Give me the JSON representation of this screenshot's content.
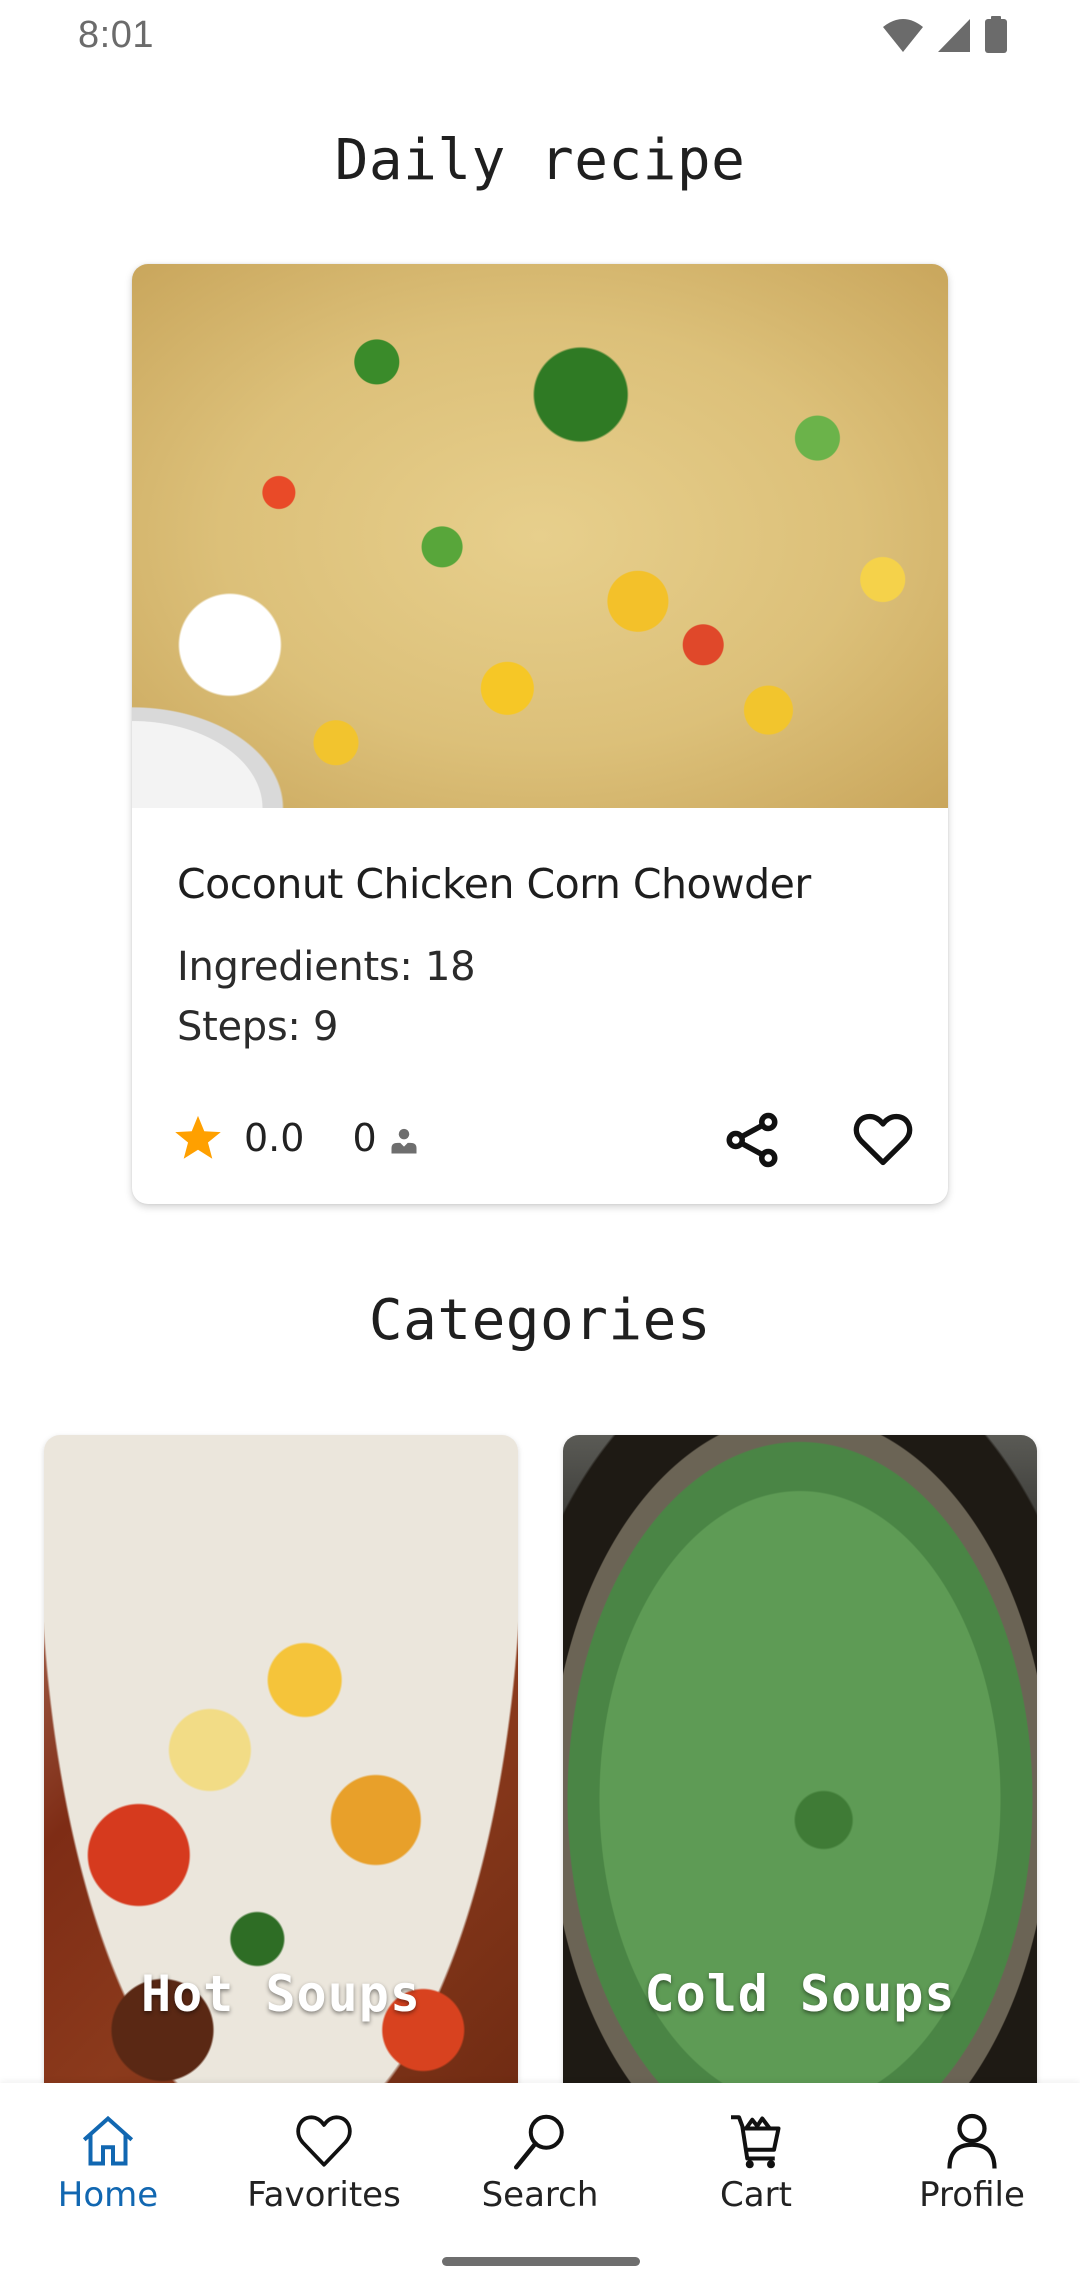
{
  "status_bar": {
    "time": "8:01",
    "icons": [
      "wifi-icon",
      "cell-signal-icon",
      "battery-icon"
    ]
  },
  "daily_recipe": {
    "section_title": "Daily recipe",
    "recipe": {
      "title": "Coconut Chicken Corn Chowder",
      "ingredients_label": "Ingredients: 18",
      "steps_label": "Steps: 9",
      "ingredients_count": 18,
      "steps_count": 9,
      "rating": "0.0",
      "ratings_count": "0",
      "image_description": "corn chowder with green onions and cilantro in a white bowl"
    },
    "actions": [
      "share-icon",
      "favorite-heart-icon"
    ],
    "colors": {
      "star": "#FFA000"
    }
  },
  "categories": {
    "section_title": "Categories",
    "items": [
      {
        "label": "Hot Soups",
        "image_description": "tortilla soup with cheese and cilantro"
      },
      {
        "label": "Cold Soups",
        "image_description": "green soup garnished with mint"
      }
    ]
  },
  "bottom_nav": {
    "items": [
      {
        "label": "Home",
        "icon": "home-icon",
        "active": true
      },
      {
        "label": "Favorites",
        "icon": "heart-icon",
        "active": false
      },
      {
        "label": "Search",
        "icon": "search-icon",
        "active": false
      },
      {
        "label": "Cart",
        "icon": "cart-icon",
        "active": false
      },
      {
        "label": "Profile",
        "icon": "profile-icon",
        "active": false
      }
    ],
    "colors": {
      "active": "#1167B1",
      "inactive": "#222222"
    }
  }
}
